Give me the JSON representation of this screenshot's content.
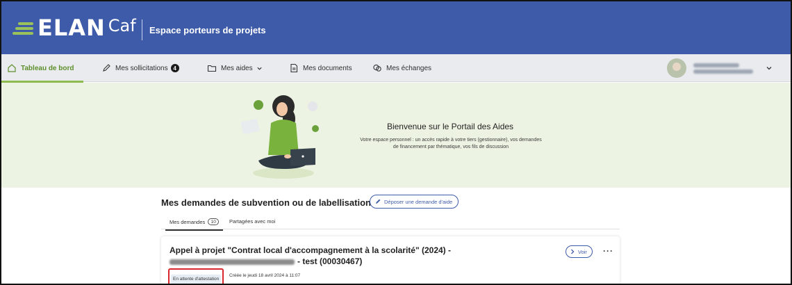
{
  "header": {
    "logo_elan": "ELAN",
    "logo_caf": "Caf",
    "title": "Espace porteurs de projets",
    "bg_color": "#3e5ba9",
    "logo_accent": "#9bc25a"
  },
  "nav": {
    "items": [
      {
        "label": "Tableau de bord",
        "icon": "home-icon",
        "active": true
      },
      {
        "label": "Mes sollicitations",
        "icon": "pencil-icon",
        "badge": "4"
      },
      {
        "label": "Mes aides",
        "icon": "folder-icon",
        "dropdown": true
      },
      {
        "label": "Mes documents",
        "icon": "document-icon"
      },
      {
        "label": "Mes échanges",
        "icon": "chat-icon"
      }
    ],
    "active_color": "#5e8f2c",
    "user": {
      "icon": "avatar-icon",
      "dropdown": true
    }
  },
  "hero": {
    "title": "Bienvenue sur le Portail des Aides",
    "description": "Votre espace personnel : un accès rapide à votre tiers (gestionnaire), vos demandes de financement par thématique, vos fils de discussion",
    "bg_color": "#edf3e3"
  },
  "main": {
    "section_title": "Mes demandes de subvention ou de labellisation",
    "add_button": "Déposer une demande d'aide",
    "tabs": [
      {
        "label": "Mes demandes",
        "count": "10",
        "active": true
      },
      {
        "label": "Partagées avec moi"
      }
    ],
    "card": {
      "title_line1": "Appel à projet \"Contrat local d'accompagnement à la scolarité\" (2024) -",
      "title_line2_suffix": "- test (00030467)",
      "voir_label": "Voir",
      "more_label": "···",
      "status": "En attente d'attestation",
      "created": "Créée le jeudi 18 avril 2024 à 11:07",
      "status_highlight_color": "#d8262c"
    }
  }
}
